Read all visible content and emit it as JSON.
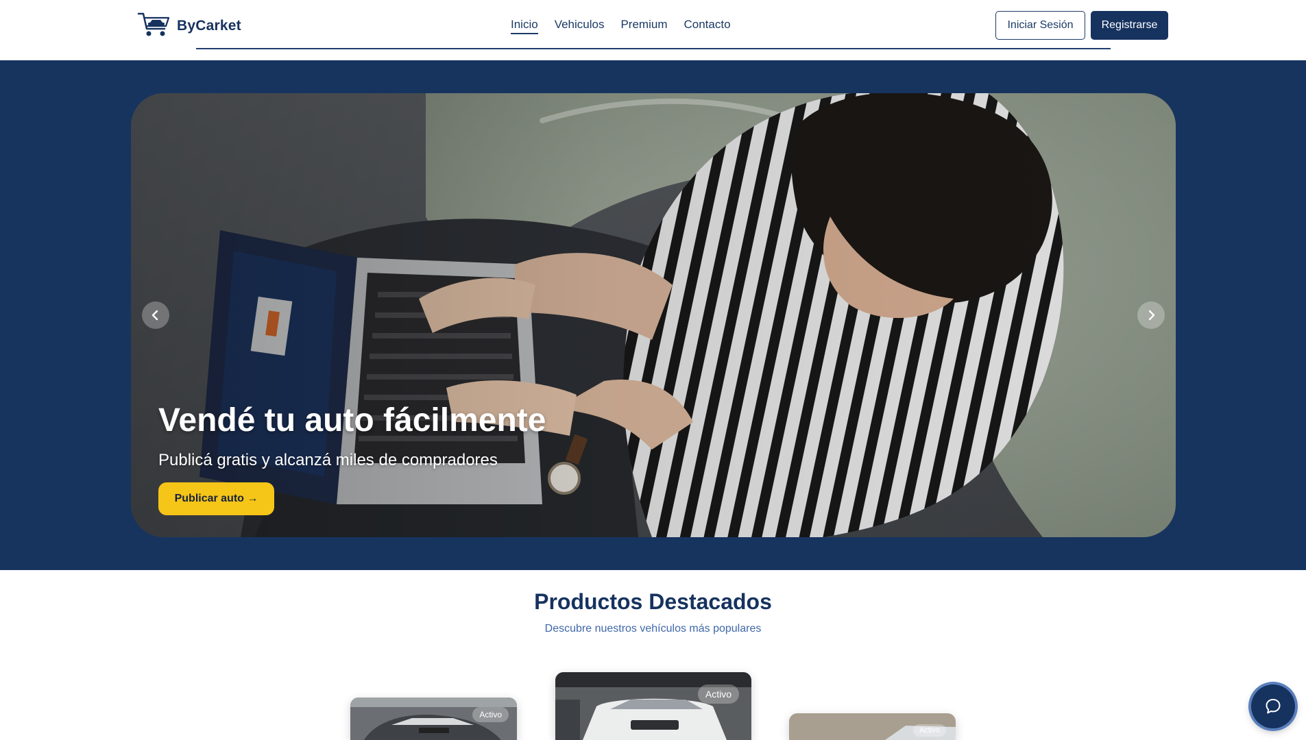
{
  "brand": {
    "name": "ByCarket",
    "logo_icon": "cart-car-icon"
  },
  "nav": {
    "items": [
      {
        "label": "Inicio",
        "active": true
      },
      {
        "label": "Vehiculos",
        "active": false
      },
      {
        "label": "Premium",
        "active": false
      },
      {
        "label": "Contacto",
        "active": false
      }
    ]
  },
  "auth": {
    "login_label": "Iniciar Sesión",
    "register_label": "Registrarse"
  },
  "hero": {
    "title": "Vendé tu auto fácilmente",
    "subtitle": "Publicá gratis y alcanzá miles de compradores",
    "cta_label": "Publicar auto →",
    "prev_icon": "chevron-left-icon",
    "next_icon": "chevron-right-icon",
    "image": "person-with-laptop-photo"
  },
  "featured": {
    "title": "Productos Destacados",
    "subtitle": "Descubre nuestros vehículos más populares",
    "cards": [
      {
        "status": "Activo"
      },
      {
        "status": "Activo"
      },
      {
        "status": "Activo"
      }
    ]
  },
  "chat": {
    "icon": "chat-bubble-icon"
  },
  "colors": {
    "primary": "#16325f",
    "hero_band": "#17345f",
    "accent_yellow": "#f5c518",
    "subtitle_blue": "#3f67a8"
  }
}
